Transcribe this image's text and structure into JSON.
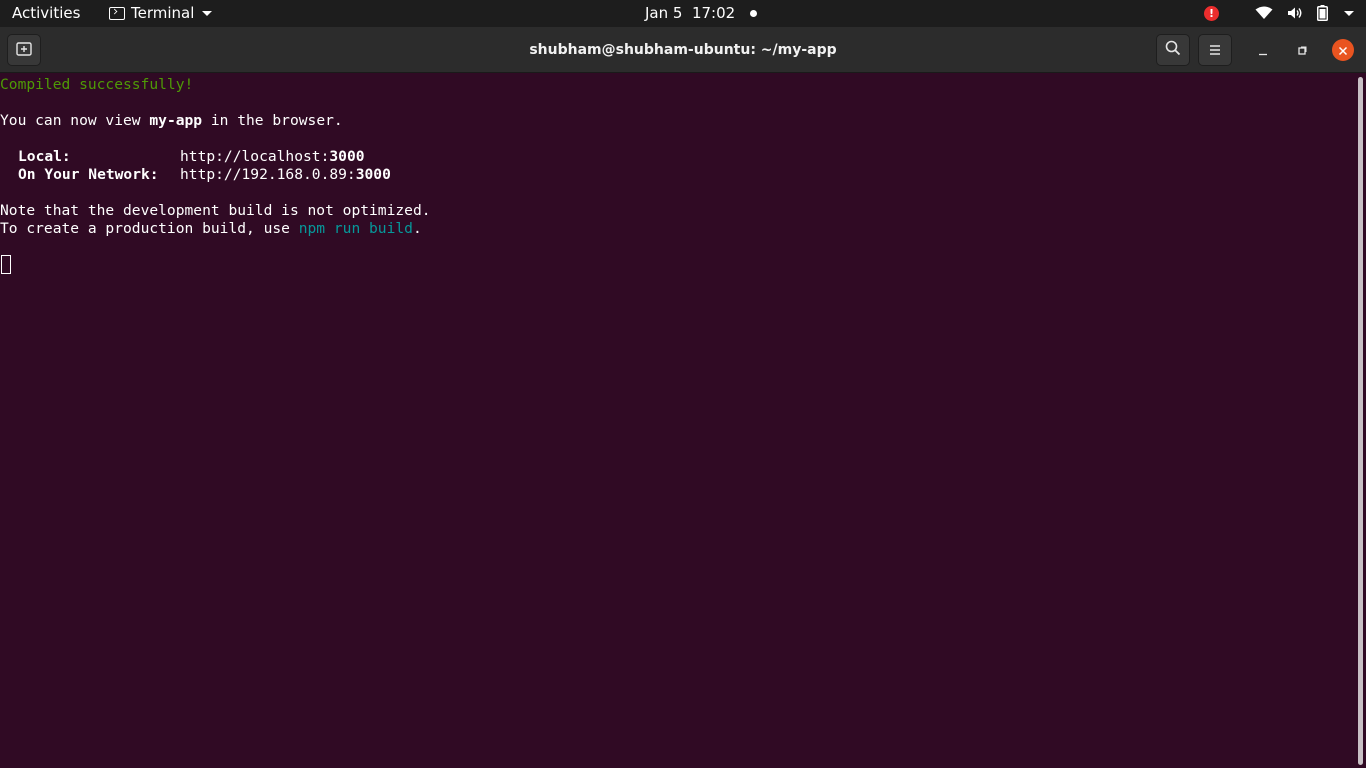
{
  "topbar": {
    "activities": "Activities",
    "app_name": "Terminal",
    "clock": "Jan 5  17:02",
    "alert_glyph": "!",
    "icons": [
      "terminal-icon",
      "notification-dot-icon",
      "alert-icon",
      "wifi-icon",
      "volume-icon",
      "battery-icon",
      "system-menu-caret-icon"
    ],
    "alert_color": "#ec2d2d"
  },
  "window": {
    "title": "shubham@shubham-ubuntu: ~/my-app",
    "icons": [
      "new-tab-icon",
      "search-icon",
      "hamburger-menu-icon",
      "minimize-icon",
      "maximize-icon",
      "close-icon"
    ],
    "close_color": "#e95420"
  },
  "terminal": {
    "background": "#300a24",
    "compiled": "Compiled successfully!",
    "view_prefix": "You can now view ",
    "app": "my-app",
    "view_suffix": " in the browser.",
    "local_label": "Local:",
    "local_url_prefix": "http://localhost:",
    "local_port": "3000",
    "network_label": "On Your Network:",
    "network_url_prefix": "http://192.168.0.89:",
    "network_port": "3000",
    "note": "Note that the development build is not optimized.",
    "prod_prefix": "To create a production build, use ",
    "prod_cmd": "npm run build",
    "prod_suffix": "."
  }
}
